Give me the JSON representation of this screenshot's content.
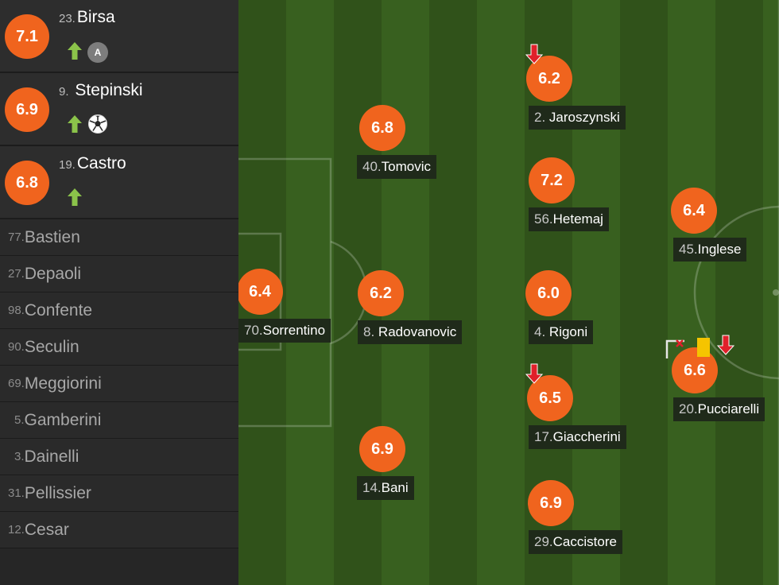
{
  "substitutes_in": [
    {
      "rating": "7.1",
      "number": "23.",
      "name": "Birsa",
      "icons": [
        "sub-on-arrow-icon",
        "assist-icon"
      ],
      "assist_label": "A"
    },
    {
      "rating": "6.9",
      "number": "9.",
      "name": "Stepinski",
      "icons": [
        "sub-on-arrow-icon",
        "goal-ball-icon"
      ]
    },
    {
      "rating": "6.8",
      "number": "19.",
      "name": "Castro",
      "icons": [
        "sub-on-arrow-icon"
      ]
    }
  ],
  "bench": [
    {
      "number": "77.",
      "name": "Bastien"
    },
    {
      "number": "27.",
      "name": "Depaoli"
    },
    {
      "number": "98.",
      "name": "Confente"
    },
    {
      "number": "90.",
      "name": "Seculin"
    },
    {
      "number": "69.",
      "name": "Meggiorini"
    },
    {
      "number": "5.",
      "name": "Gamberini"
    },
    {
      "number": "3.",
      "name": "Dainelli"
    },
    {
      "number": "31.",
      "name": "Pellissier"
    },
    {
      "number": "12.",
      "name": "Cesar"
    }
  ],
  "players": [
    {
      "rating": "6.4",
      "number": "70.",
      "name": "Sorrentino",
      "icons": []
    },
    {
      "rating": "6.8",
      "number": "40.",
      "name": "Tomovic",
      "icons": []
    },
    {
      "rating": "6.2",
      "number": "8.",
      "name": "Radovanovic",
      "icons": []
    },
    {
      "rating": "6.9",
      "number": "14.",
      "name": "Bani",
      "icons": []
    },
    {
      "rating": "6.2",
      "number": "2.",
      "name": "Jaroszynski",
      "icons": [
        "sub-off-arrow-icon"
      ]
    },
    {
      "rating": "7.2",
      "number": "56.",
      "name": "Hetemaj",
      "icons": []
    },
    {
      "rating": "6.0",
      "number": "4.",
      "name": "Rigoni",
      "icons": []
    },
    {
      "rating": "6.5",
      "number": "17.",
      "name": "Giaccherini",
      "icons": [
        "sub-off-arrow-icon"
      ]
    },
    {
      "rating": "6.9",
      "number": "29.",
      "name": "Caccistore",
      "icons": []
    },
    {
      "rating": "6.4",
      "number": "45.",
      "name": "Inglese",
      "icons": []
    },
    {
      "rating": "6.6",
      "number": "20.",
      "name": "Pucciarelli",
      "icons": [
        "missed-shot-icon",
        "yellow-card-icon",
        "sub-off-arrow-icon"
      ]
    }
  ],
  "colors": {
    "rating_badge": "#f0641e",
    "sub_on": "#8bc34a",
    "sub_off": "#e0202a",
    "yellow_card": "#f5c400",
    "pitch_dark": "#30521a",
    "pitch_light": "#38601f"
  }
}
